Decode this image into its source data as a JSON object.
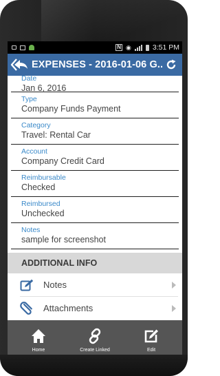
{
  "status_bar": {
    "time": "3:51 PM"
  },
  "app_bar": {
    "title": "EXPENSES - 2016-01-06 G.."
  },
  "fields": [
    {
      "label": "Date",
      "value": "Jan 6, 2016"
    },
    {
      "label": "Type",
      "value": "Company Funds Payment"
    },
    {
      "label": "Category",
      "value": "Travel: Rental Car"
    },
    {
      "label": "Account",
      "value": "Company Credit Card"
    },
    {
      "label": "Reimbursable",
      "value": "Checked"
    },
    {
      "label": "Reimbursed",
      "value": "Unchecked"
    },
    {
      "label": "Notes",
      "value": "sample for screenshot"
    }
  ],
  "additional_info": {
    "header": "ADDITIONAL INFO",
    "items": [
      {
        "label": "Notes",
        "icon": "pencil-note-icon"
      },
      {
        "label": "Attachments",
        "icon": "paperclip-icon"
      }
    ]
  },
  "bottom_bar": {
    "home_label": "Home",
    "create_linked_label": "Create Linked",
    "edit_label": "Edit"
  },
  "colors": {
    "app_bar": "#3a6aa3",
    "field_label": "#3a89c9",
    "section_header_bg": "#d8d8d8",
    "bottom_bar": "#555555"
  }
}
